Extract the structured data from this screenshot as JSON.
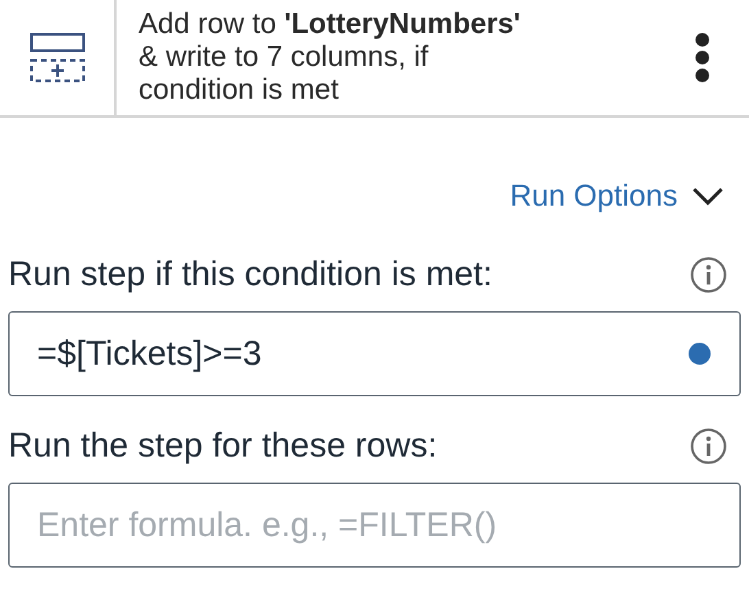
{
  "step": {
    "title": "Add row to **'LotteryNumbers'** & write to 7 columns, if condition is met"
  },
  "run_options": {
    "label": "Run Options",
    "expanded": true
  },
  "fields": [
    {
      "label": "Run step if this condition is met:",
      "value": "=$[Tickets]>=3",
      "modified": true
    },
    {
      "label": "Run the step for these rows:",
      "placeholder": "Enter formula. e.g., =FILTER()",
      "modified": false
    }
  ]
}
